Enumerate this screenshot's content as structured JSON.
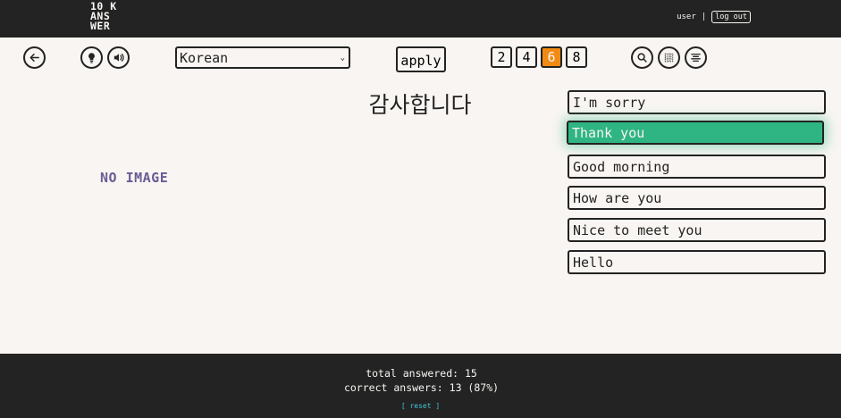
{
  "header": {
    "logo_lines": [
      "10 K",
      "ANS",
      "WER"
    ],
    "user": "user",
    "separator": "|",
    "logout_label": "log out"
  },
  "toolbar": {
    "back_icon": "arrow-left-icon",
    "hint_icon": "lightbulb-icon",
    "audio_icon": "speaker-icon",
    "language_selected": "Korean",
    "apply_label": "apply",
    "counts": [
      "2",
      "4",
      "6",
      "8"
    ],
    "active_count": "6",
    "search_icon": "search-icon",
    "grid_icon": "grid-icon",
    "list_icon": "align-center-icon"
  },
  "main": {
    "prompt": "감사합니다",
    "image_placeholder": "NO IMAGE",
    "answers": [
      {
        "label": "I'm sorry",
        "state": "default"
      },
      {
        "label": "Thank you",
        "state": "correct"
      },
      {
        "label": "Good morning",
        "state": "default"
      },
      {
        "label": "How are you",
        "state": "default"
      },
      {
        "label": "Nice to meet you",
        "state": "default"
      },
      {
        "label": "Hello",
        "state": "default"
      }
    ]
  },
  "footer": {
    "total_answered": "total answered: 15",
    "correct_answers": "correct answers: 13 (87%)",
    "reset_label": "[ reset ]"
  },
  "colors": {
    "dark": "#232323",
    "background": "#f8f5f2",
    "accent_orange": "#f08a12",
    "correct_green": "#2fb584",
    "placeholder_purple": "#6b5b95",
    "reset_cyan": "#3fc6d8"
  }
}
